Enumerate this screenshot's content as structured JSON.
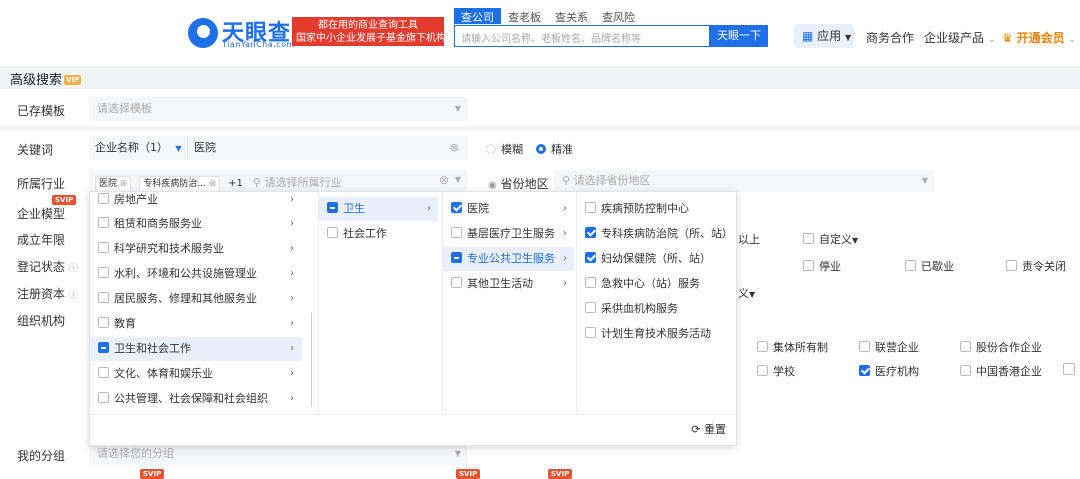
{
  "header": {
    "logo_cn": "天眼查",
    "logo_en": "TianYanCha.com",
    "slogan_line1": "都在用的商业查询工具",
    "slogan_line2": "国家中小企业发展子基金旗下机构",
    "search_tabs": [
      "查公司",
      "查老板",
      "查关系",
      "查风险"
    ],
    "search_placeholder": "请输入公司名称、老板姓名、品牌名称等",
    "search_button": "天眼一下",
    "nav_app": "应用",
    "nav_business": "商务合作",
    "nav_enterprise": "企业级产品",
    "nav_vip": "开通会员"
  },
  "page": {
    "title": "高级搜索",
    "vip_badge": "VIP",
    "svip_badge": "SVIP"
  },
  "saved_template": {
    "label": "已存模板",
    "placeholder": "请选择模板"
  },
  "filters": {
    "keyword_label": "关键词",
    "keyword_type": "企业名称（1）",
    "keyword_value": "医院",
    "match_fuzzy": "模糊",
    "match_exact": "精准",
    "industry_label": "所属行业",
    "industry_tags": [
      "医院",
      "专科疾病防治..."
    ],
    "industry_more": "+1",
    "industry_placeholder": "请选择所属行业",
    "province_label": "省份地区",
    "province_placeholder": "请选择省份地区",
    "model_label": "企业模型",
    "established_label": "成立年限",
    "status_label": "登记状态",
    "capital_label": "注册资本",
    "org_label": "组织机构",
    "group_label": "我的分组",
    "group_placeholder": "请选择您的分组"
  },
  "right_options": {
    "established_more": "以上",
    "custom": "自定义",
    "status": [
      "停业",
      "已歇业",
      "责令关闭"
    ],
    "capital_custom": "义",
    "org_row1": [
      "集体所有制",
      "联营企业",
      "股份合作企业"
    ],
    "org_row2": [
      "学校",
      "医疗机构",
      "中国香港企业"
    ]
  },
  "cascader": {
    "col1": [
      {
        "label": "房地产业",
        "checked": false
      },
      {
        "label": "租赁和商务服务业",
        "checked": false
      },
      {
        "label": "科学研究和技术服务业",
        "checked": false
      },
      {
        "label": "水利、环境和公共设施管理业",
        "checked": false
      },
      {
        "label": "居民服务、修理和其他服务业",
        "checked": false
      },
      {
        "label": "教育",
        "checked": false
      },
      {
        "label": "卫生和社会工作",
        "checked": "half"
      },
      {
        "label": "文化、体育和娱乐业",
        "checked": false
      },
      {
        "label": "公共管理、社会保障和社会组织",
        "checked": false
      }
    ],
    "col2": [
      {
        "label": "卫生",
        "checked": "half"
      },
      {
        "label": "社会工作",
        "checked": false
      }
    ],
    "col3": [
      {
        "label": "医院",
        "checked": true
      },
      {
        "label": "基层医疗卫生服务",
        "checked": false
      },
      {
        "label": "专业公共卫生服务",
        "checked": "half"
      },
      {
        "label": "其他卫生活动",
        "checked": false
      }
    ],
    "col4": [
      {
        "label": "疾病预防控制中心",
        "checked": false
      },
      {
        "label": "专科疾病防治院（所、站）",
        "checked": true
      },
      {
        "label": "妇幼保健院（所、站）",
        "checked": true
      },
      {
        "label": "急救中心（站）服务",
        "checked": false
      },
      {
        "label": "采供血机构服务",
        "checked": false
      },
      {
        "label": "计划生育技术服务活动",
        "checked": false
      }
    ],
    "reset": "重置"
  },
  "colors": {
    "brand": "#1f6fe8",
    "slogan": "#e53b2e",
    "vip": "#e8860c"
  }
}
